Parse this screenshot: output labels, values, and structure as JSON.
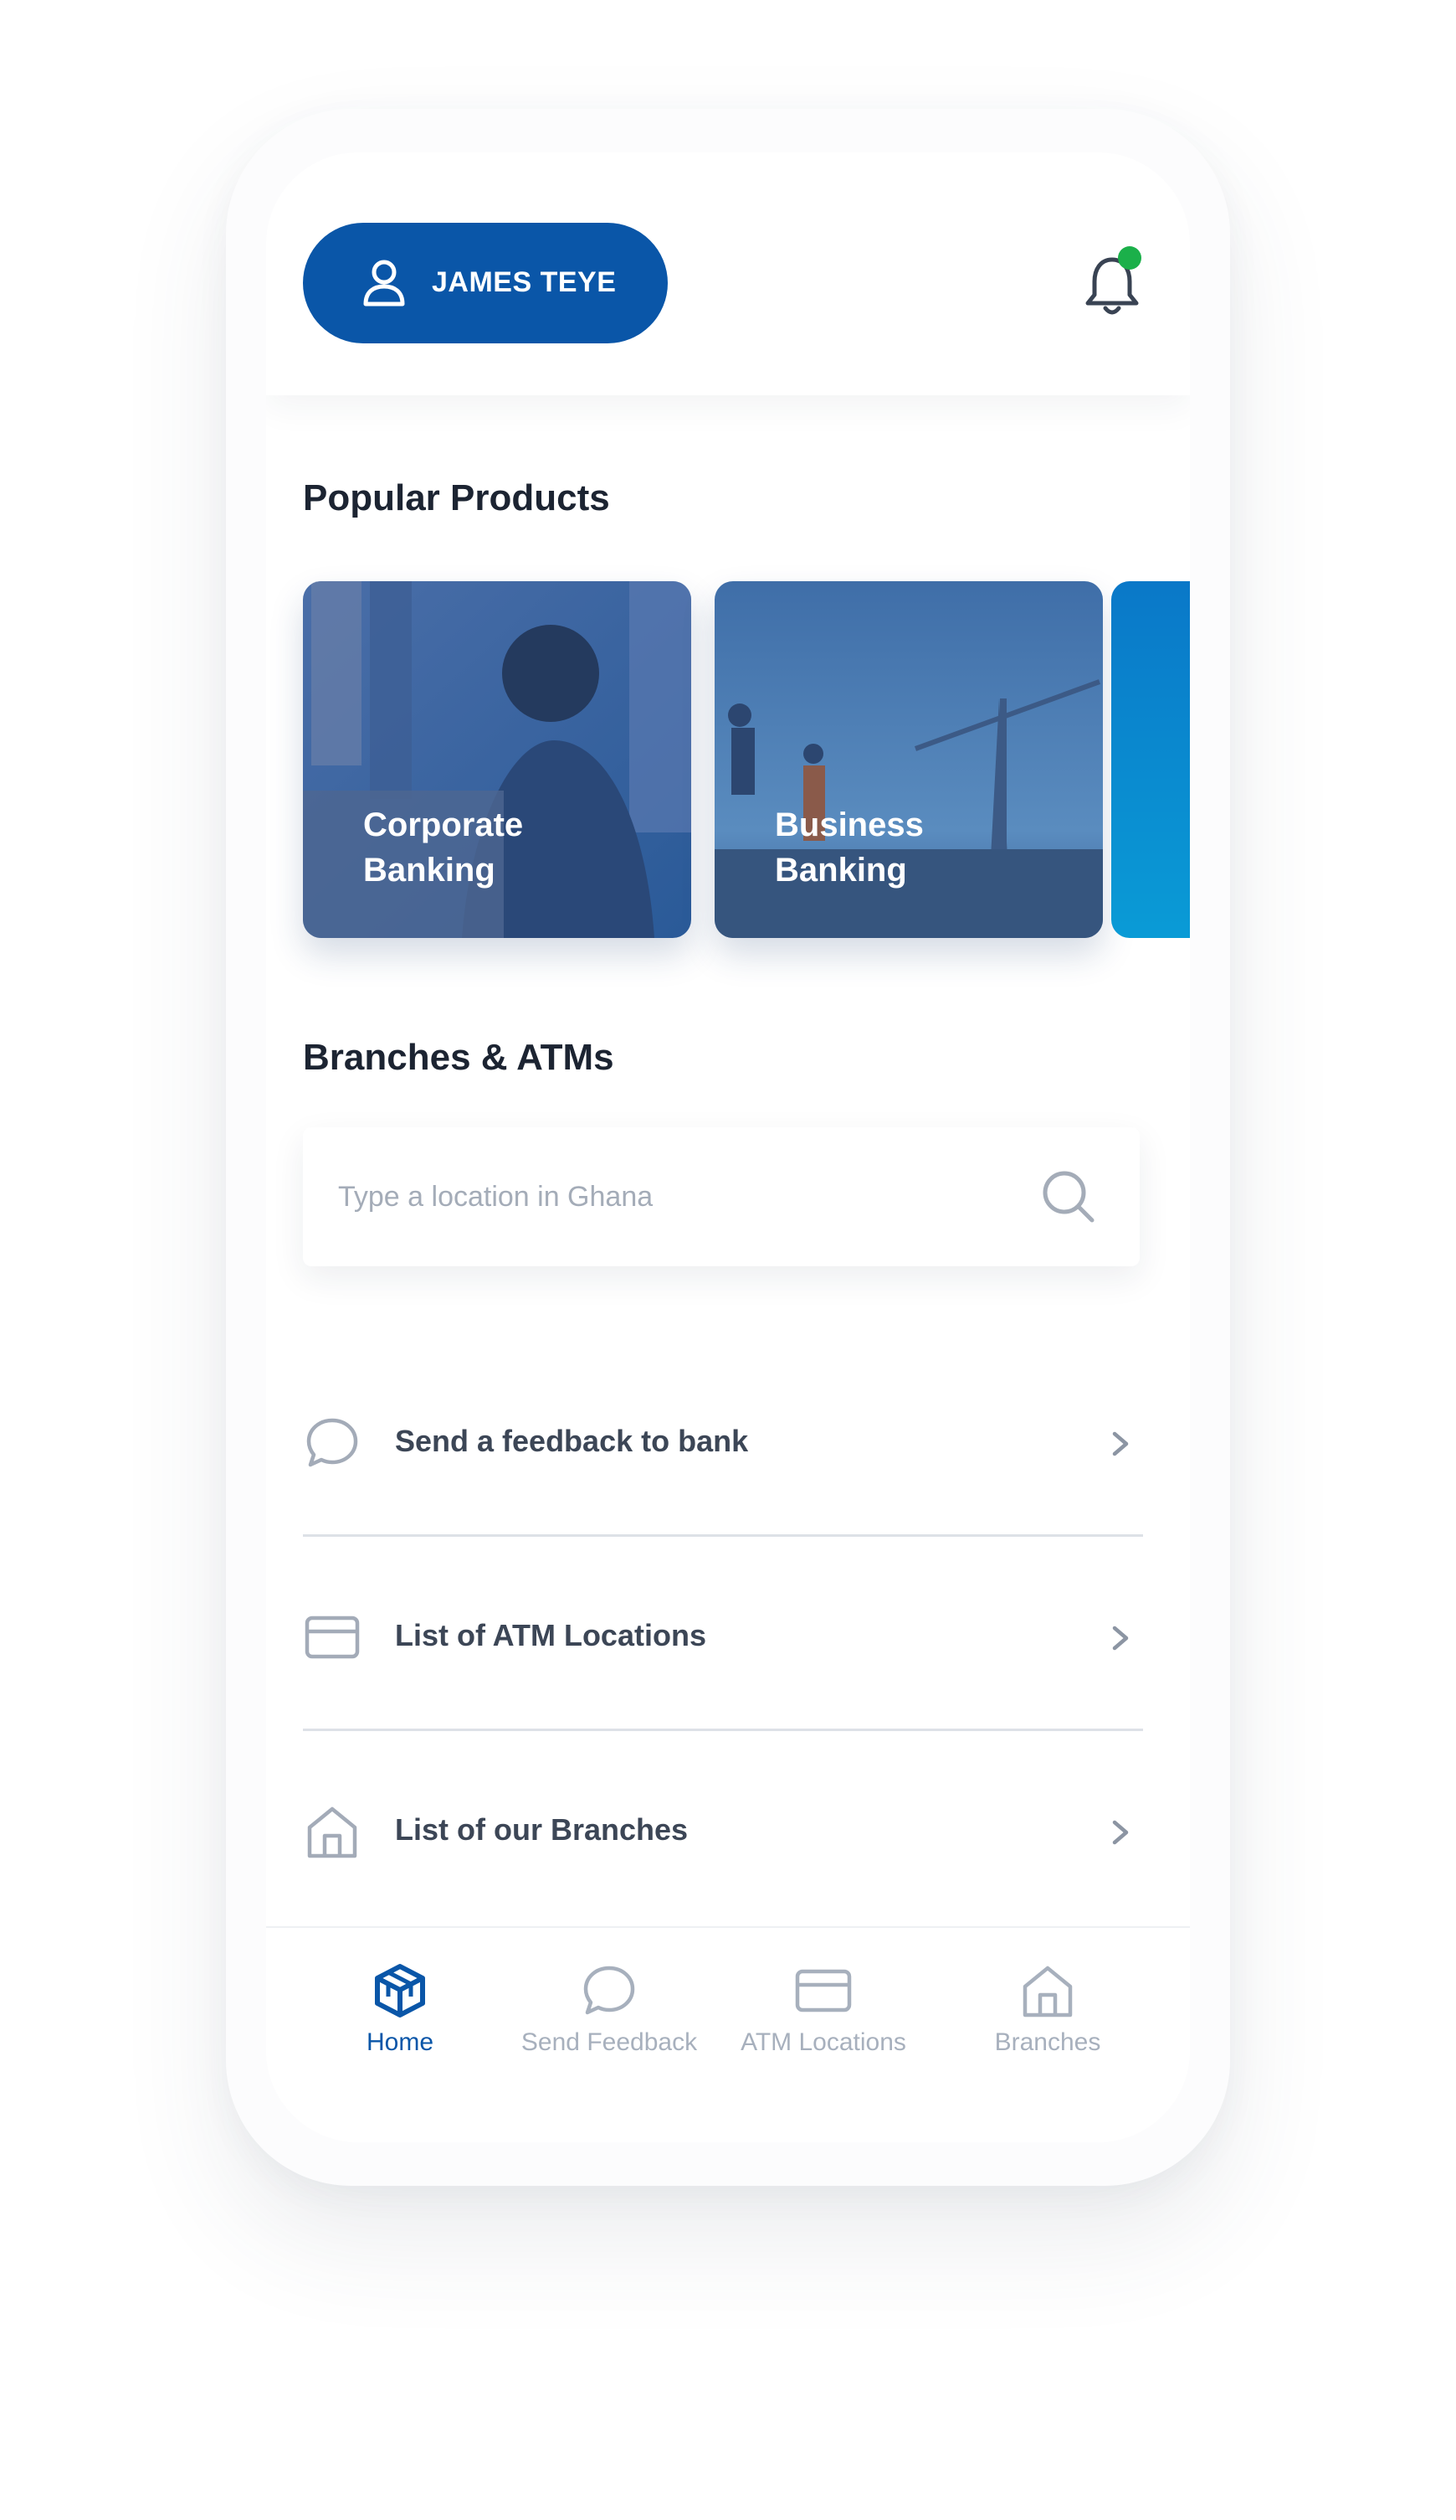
{
  "header": {
    "user_name": "JAMES TEYE"
  },
  "popular_products": {
    "title": "Popular Products",
    "cards": [
      {
        "label": "Corporate\nBanking"
      },
      {
        "label": "Business\nBanking"
      }
    ]
  },
  "branches_atms": {
    "title": "Branches & ATMs",
    "search_placeholder": "Type a location in Ghana"
  },
  "list": [
    {
      "label": "Send a feedback to bank",
      "icon": "chat-bubble-icon"
    },
    {
      "label": "List of ATM Locations",
      "icon": "card-icon"
    },
    {
      "label": "List of our Branches",
      "icon": "house-icon"
    }
  ],
  "bottom_nav": [
    {
      "label": "Home",
      "icon": "cube-icon",
      "active": true
    },
    {
      "label": "Send Feedback",
      "icon": "chat-bubble-icon",
      "active": false
    },
    {
      "label": "ATM Locations",
      "icon": "card-icon",
      "active": false
    },
    {
      "label": "Branches",
      "icon": "house-icon",
      "active": false
    }
  ],
  "colors": {
    "brand_blue": "#0a56a8",
    "notification_dot": "#1bb04a",
    "inactive_gray": "#a7b0bd"
  }
}
